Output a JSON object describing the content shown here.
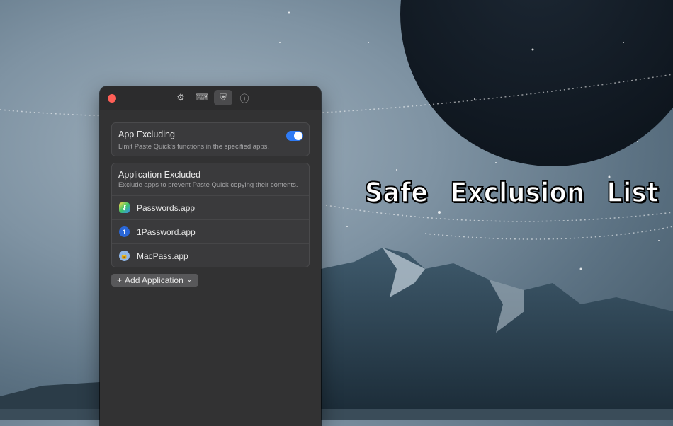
{
  "headline": "Safe Exclusion List",
  "window": {
    "toolbar": {
      "items": [
        {
          "icon": "gear-icon",
          "glyph": "⚙",
          "active": false
        },
        {
          "icon": "keyboard-icon",
          "glyph": "⌨",
          "active": false
        },
        {
          "icon": "shield-icon",
          "glyph": "⛨",
          "active": true
        },
        {
          "icon": "info-icon",
          "glyph": "ⓘ",
          "active": false
        }
      ]
    },
    "app_excluding": {
      "title": "App Excluding",
      "subtitle": "Limit Paste Quick's functions in the specified apps.",
      "enabled": true
    },
    "excluded": {
      "title": "Application Excluded",
      "subtitle": "Exclude apps to prevent Paste Quick copying their contents.",
      "apps": [
        {
          "name": "Passwords.app",
          "icon": "passwords-app-icon"
        },
        {
          "name": "1Password.app",
          "icon": "1password-app-icon"
        },
        {
          "name": "MacPass.app",
          "icon": "macpass-app-icon"
        }
      ]
    },
    "add_button": {
      "plus": "+",
      "label": "Add Application",
      "chevron": "⌄"
    }
  },
  "colors": {
    "accent": "#2f7bf5",
    "close": "#ff5f57",
    "window_bg": "#323233"
  }
}
